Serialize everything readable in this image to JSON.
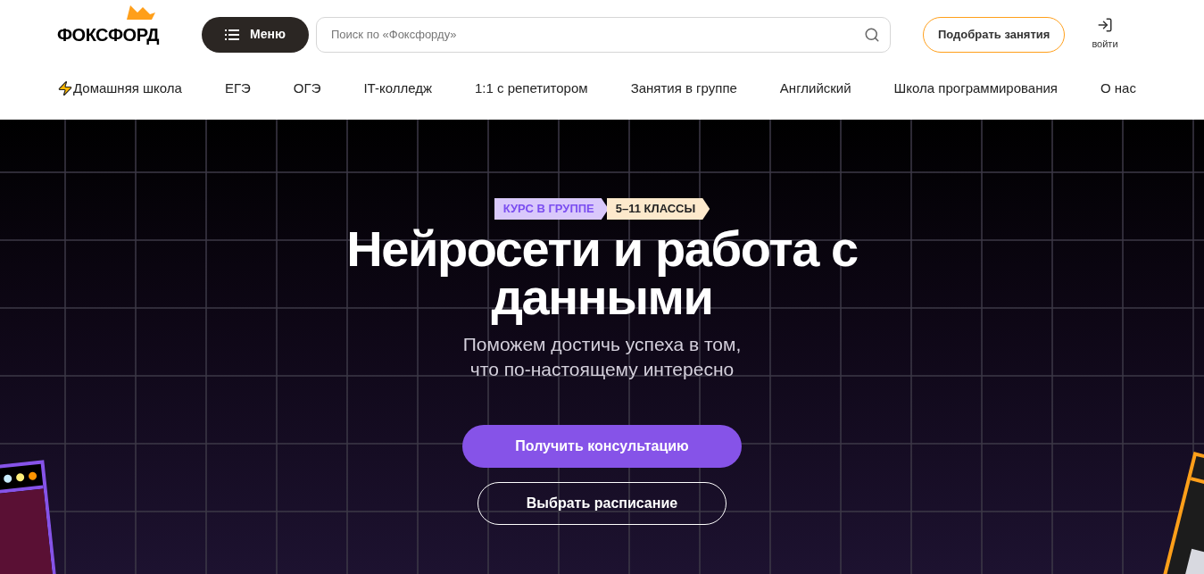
{
  "header": {
    "logo": "ФОКСФОРД",
    "menu_button": "Меню",
    "search": {
      "placeholder": "Поиск по «Фоксфорду»"
    },
    "pick_button": "Подобрать занятия",
    "login": "войти"
  },
  "nav": [
    {
      "label": "Домашняя школа",
      "kind": "bolt"
    },
    {
      "label": "ЕГЭ",
      "kind": "plain"
    },
    {
      "label": "ОГЭ",
      "kind": "plain"
    },
    {
      "label": "IT-колледж",
      "kind": "plain"
    },
    {
      "label": "1:1 с репетитором",
      "kind": "plain"
    },
    {
      "label": "Занятия в группе",
      "kind": "plain"
    },
    {
      "label": "Английский",
      "kind": "plain"
    },
    {
      "label": "Школа программирования",
      "kind": "plain"
    },
    {
      "label": "О нас",
      "kind": "plain"
    }
  ],
  "hero": {
    "tags": [
      {
        "label": "КУРС В ГРУППЕ",
        "color": "#d9c8fb"
      },
      {
        "label": "5–11 КЛАССЫ",
        "color": "#fde9cc"
      }
    ],
    "title": "Нейросети и работа с данными",
    "subtitle_lines": [
      "Поможем достичь успеха в том,",
      "что по-настоящему интересно"
    ],
    "primary_button": "Получить консультацию",
    "secondary_button": "Выбрать расписание",
    "window_dots": [
      {
        "color": "#c9ecfb"
      },
      {
        "color": "#fef07a"
      },
      {
        "color": "#ff9500"
      }
    ]
  }
}
